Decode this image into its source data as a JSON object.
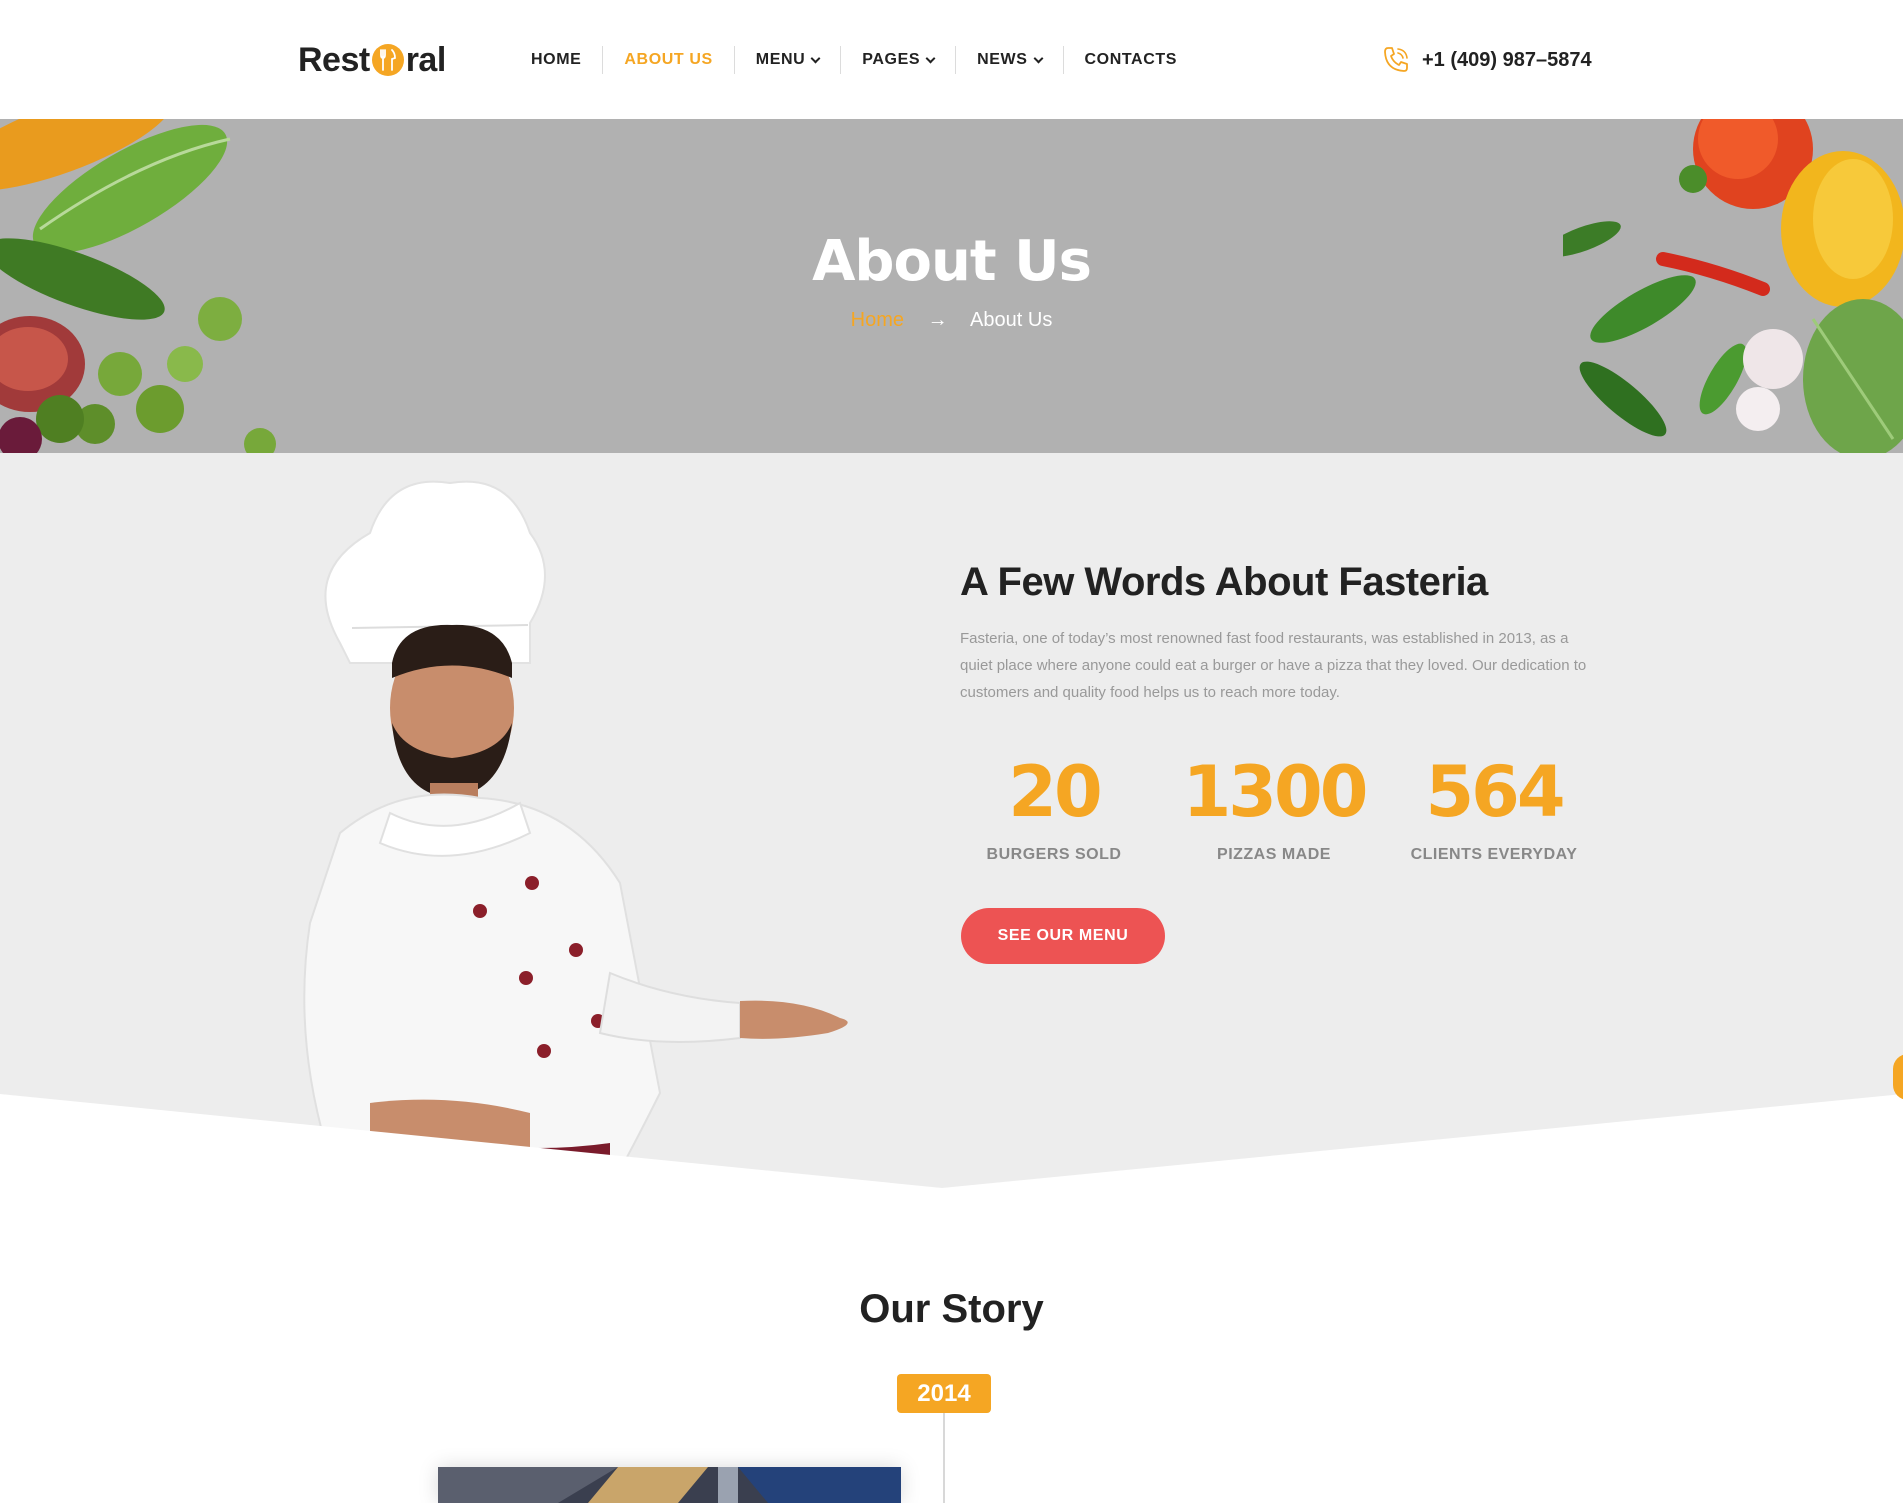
{
  "brand": {
    "logo_left": "Rest",
    "logo_right": "ral",
    "accent": "#f5a623",
    "button_color": "#ed5353"
  },
  "nav": {
    "items": [
      {
        "label": "HOME",
        "active": false,
        "dropdown": false
      },
      {
        "label": "ABOUT US",
        "active": true,
        "dropdown": false
      },
      {
        "label": "MENU",
        "active": false,
        "dropdown": true
      },
      {
        "label": "PAGES",
        "active": false,
        "dropdown": true
      },
      {
        "label": "NEWS",
        "active": false,
        "dropdown": true
      },
      {
        "label": "CONTACTS",
        "active": false,
        "dropdown": false
      }
    ]
  },
  "phone": {
    "icon": "phone-icon",
    "number": "+1 (409) 987–5874"
  },
  "hero": {
    "title": "About Us",
    "breadcrumb": {
      "home": "Home",
      "separator": "→",
      "current": "About Us"
    }
  },
  "about": {
    "heading": "A Few Words About Fasteria",
    "text": "Fasteria, one of today’s most renowned fast food restaurants, was established in 2013, as a quiet place where anyone could eat a burger or have a pizza that they loved. Our dedication to customers and quality food helps us to reach more today.",
    "stats": [
      {
        "value": "20",
        "label": "BURGERS SOLD"
      },
      {
        "value": "1300",
        "label": "PIZZAS MADE"
      },
      {
        "value": "564",
        "label": "CLIENTS EVERYDAY"
      }
    ],
    "button": "SEE OUR MENU"
  },
  "story": {
    "title": "Our Story",
    "year": "2014"
  }
}
